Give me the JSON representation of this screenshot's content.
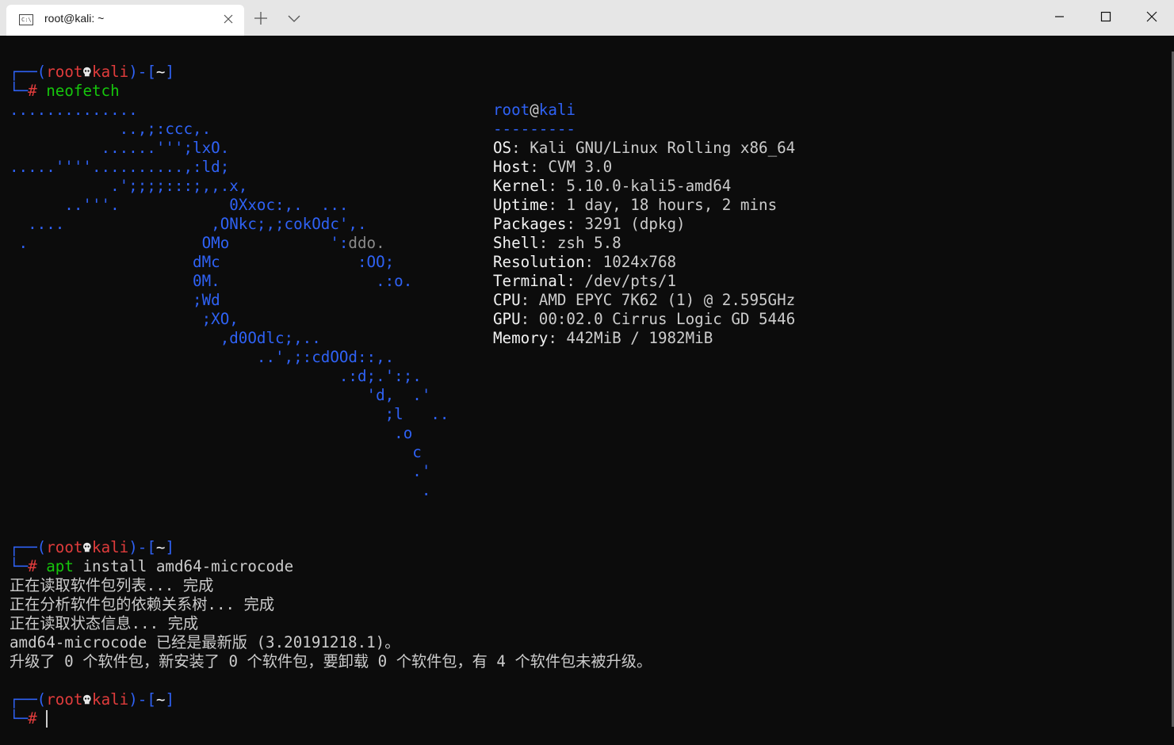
{
  "window": {
    "tab_title": "root@kali: ~",
    "tab_icon_text": "C:\\",
    "controls": [
      "minimize",
      "maximize",
      "close"
    ]
  },
  "colors": {
    "background": "#0c0c0c",
    "prompt_bracket": "#2f62f5",
    "prompt_user": "#e03c3c",
    "command": "#16c60c",
    "logo": "#2f62f5",
    "text": "#cccccc"
  },
  "prompt": {
    "open": "┌──(",
    "user": "root",
    "host": "kali",
    "mid": ")-[",
    "path": "~",
    "close": "]",
    "second_prefix": "└─",
    "symbol": "#"
  },
  "commands": {
    "neofetch": "neofetch",
    "apt_word": "apt",
    "apt_rest": " install amd64-microcode"
  },
  "logo_lines": [
    "..............",
    "            ..,;:ccc,.",
    "          ......''';lxO.",
    ".....''''..........,:ld;",
    "           .';;;;:::;,,.x,",
    "      ..'''.            0Xxoc:,.  ...",
    "  ....                ,ONkc;,;cokOdc',.",
    " .                   OMo           ':",
    "                    dMc               :OO;",
    "                    0M.                 .:o.",
    "                    ;Wd",
    "                     ;XO,",
    "                       ,d0Odlc;,..",
    "                           ..',;:cdOOd::,.",
    "                                    .:d;.':;.",
    "                                       'd,  .'",
    "                                         ;l   ..",
    "                                          .o",
    "                                            c",
    "                                            .'",
    "                                             ."
  ],
  "logo_gray_tail": "ddo.",
  "logo_blue_end": "",
  "info": {
    "user": "root",
    "at": "@",
    "host": "kali",
    "separator": "---------",
    "rows": [
      {
        "key": "OS",
        "value": "Kali GNU/Linux Rolling x86_64"
      },
      {
        "key": "Host",
        "value": "CVM 3.0"
      },
      {
        "key": "Kernel",
        "value": "5.10.0-kali5-amd64"
      },
      {
        "key": "Uptime",
        "value": "1 day, 18 hours, 2 mins"
      },
      {
        "key": "Packages",
        "value": "3291 (dpkg)"
      },
      {
        "key": "Shell",
        "value": "zsh 5.8"
      },
      {
        "key": "Resolution",
        "value": "1024x768"
      },
      {
        "key": "Terminal",
        "value": "/dev/pts/1"
      },
      {
        "key": "CPU",
        "value": "AMD EPYC 7K62 (1) @ 2.595GHz"
      },
      {
        "key": "GPU",
        "value": "00:02.0 Cirrus Logic GD 5446"
      },
      {
        "key": "Memory",
        "value": "442MiB / 1982MiB"
      }
    ]
  },
  "apt_output": [
    "正在读取软件包列表... 完成",
    "正在分析软件包的依赖关系树... 完成",
    "正在读取状态信息... 完成",
    "amd64-microcode 已经是最新版 (3.20191218.1)。",
    "升级了 0 个软件包，新安装了 0 个软件包，要卸载 0 个软件包，有 4 个软件包未被升级。"
  ]
}
